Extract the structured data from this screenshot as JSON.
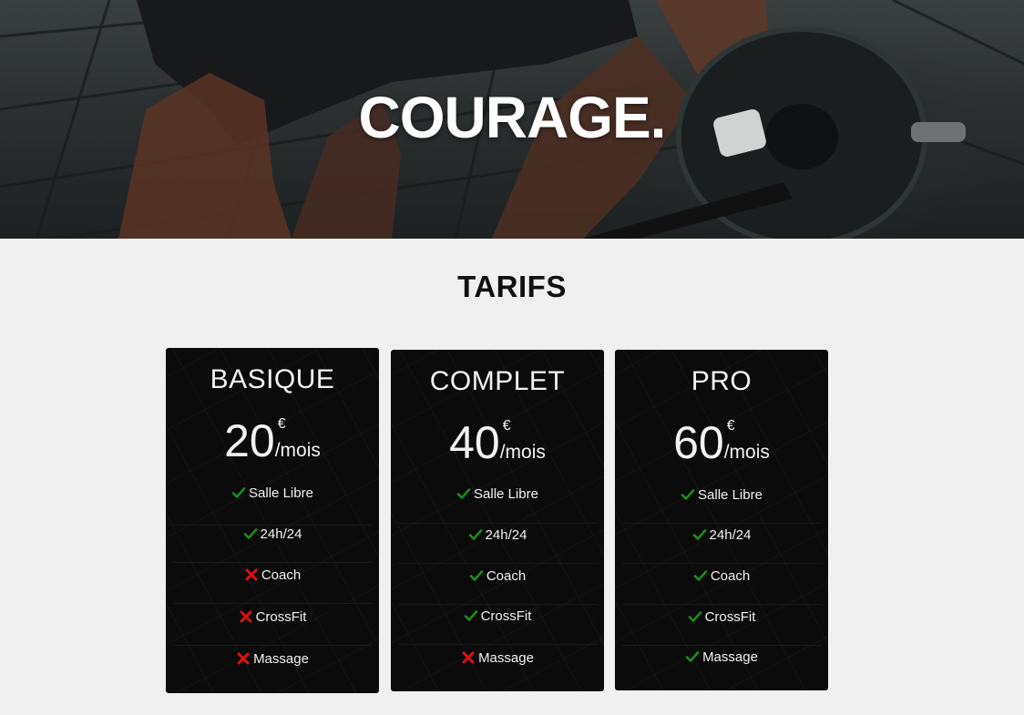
{
  "hero": {
    "title": "COURAGE."
  },
  "pricing": {
    "title": "TARIFS",
    "plans": [
      {
        "name": "BASIQUE",
        "amount": "20",
        "currency": "€",
        "period": "/mois",
        "features": [
          {
            "label": "Salle Libre",
            "included": true
          },
          {
            "label": "24h/24",
            "included": true
          },
          {
            "label": "Coach",
            "included": false
          },
          {
            "label": "CrossFit",
            "included": false
          },
          {
            "label": "Massage",
            "included": false
          }
        ]
      },
      {
        "name": "COMPLET",
        "amount": "40",
        "currency": "€",
        "period": "/mois",
        "features": [
          {
            "label": "Salle Libre",
            "included": true
          },
          {
            "label": "24h/24",
            "included": true
          },
          {
            "label": "Coach",
            "included": true
          },
          {
            "label": "CrossFit",
            "included": true
          },
          {
            "label": "Massage",
            "included": false
          }
        ]
      },
      {
        "name": "PRO",
        "amount": "60",
        "currency": "€",
        "period": "/mois",
        "features": [
          {
            "label": "Salle Libre",
            "included": true
          },
          {
            "label": "24h/24",
            "included": true
          },
          {
            "label": "Coach",
            "included": true
          },
          {
            "label": "CrossFit",
            "included": true
          },
          {
            "label": "Massage",
            "included": true
          }
        ]
      }
    ]
  },
  "colors": {
    "page_background": "#f0f0f0",
    "card_background": "#0b0b0b",
    "check": "#1e8c1e",
    "cross": "#e01010",
    "hero_text": "#ffffff"
  },
  "icons": {
    "included": "check-icon",
    "excluded": "cross-icon"
  }
}
